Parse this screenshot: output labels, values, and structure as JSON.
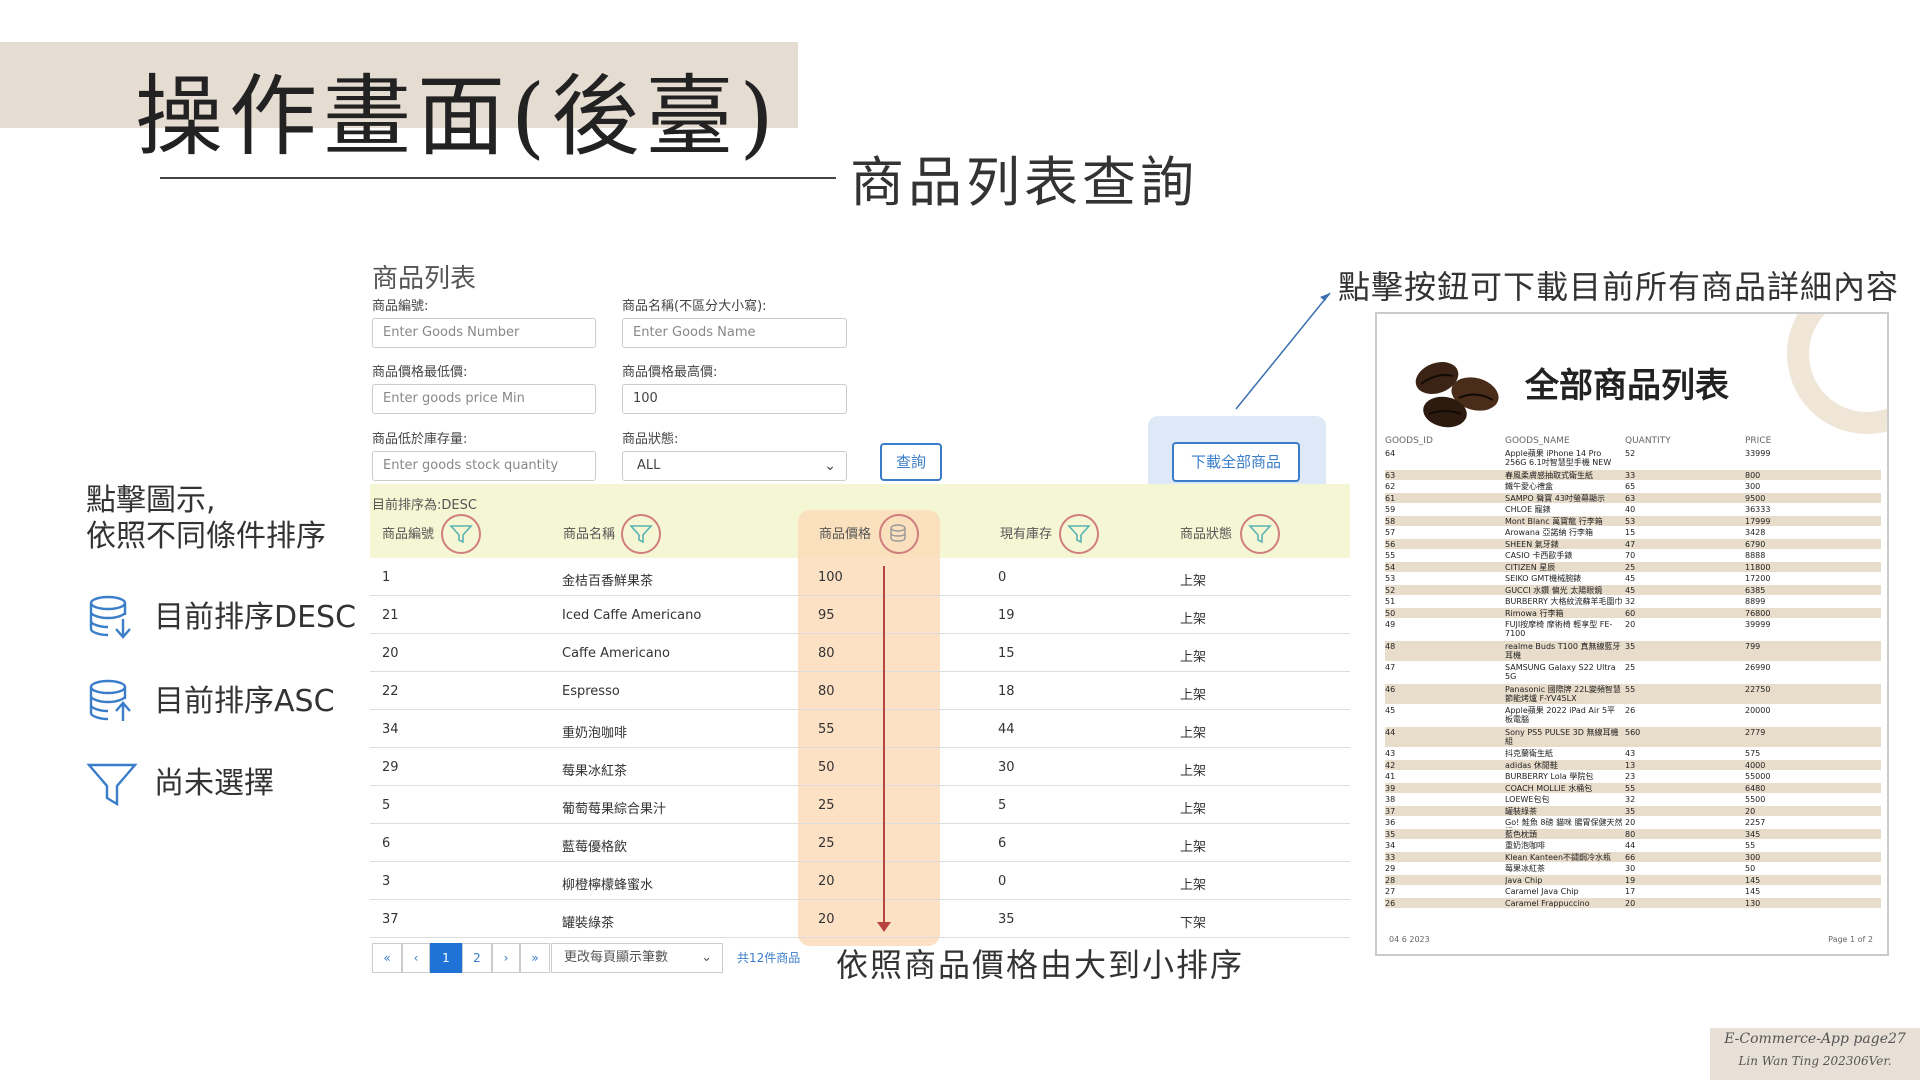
{
  "slide": {
    "title": "操作畫面(後臺)",
    "subtitle": "商品列表查詢",
    "footer_line1": "E-Commerce-App page27",
    "footer_line2": "Lin Wan Ting 202306Ver."
  },
  "form": {
    "title": "商品列表",
    "goods_number_label": "商品編號:",
    "goods_number_placeholder": "Enter Goods Number",
    "goods_name_label": "商品名稱(不區分大小寫):",
    "goods_name_placeholder": "Enter Goods Name",
    "price_min_label": "商品價格最低價:",
    "price_min_placeholder": "Enter goods price Min",
    "price_max_label": "商品價格最高價:",
    "price_max_value": "100",
    "stock_label": "商品低於庫存量:",
    "stock_placeholder": "Enter goods stock quantity",
    "status_label": "商品狀態:",
    "status_value": "ALL",
    "query_button": "查詢",
    "download_button": "下載全部商品"
  },
  "table": {
    "current_sort": "目前排序為:DESC",
    "columns": [
      "商品編號",
      "商品名稱",
      "商品價格",
      "現有庫存",
      "商品狀態"
    ],
    "rows": [
      {
        "id": "1",
        "name": "金桔百香鮮果茶",
        "price": "100",
        "stock": "0",
        "status": "上架"
      },
      {
        "id": "21",
        "name": "Iced Caffe Americano",
        "price": "95",
        "stock": "19",
        "status": "上架"
      },
      {
        "id": "20",
        "name": "Caffe Americano",
        "price": "80",
        "stock": "15",
        "status": "上架"
      },
      {
        "id": "22",
        "name": "Espresso",
        "price": "80",
        "stock": "18",
        "status": "上架"
      },
      {
        "id": "34",
        "name": "重奶泡咖啡",
        "price": "55",
        "stock": "44",
        "status": "上架"
      },
      {
        "id": "29",
        "name": "莓果冰紅茶",
        "price": "50",
        "stock": "30",
        "status": "上架"
      },
      {
        "id": "5",
        "name": "葡萄莓果綜合果汁",
        "price": "25",
        "stock": "5",
        "status": "上架"
      },
      {
        "id": "6",
        "name": "藍莓優格飲",
        "price": "25",
        "stock": "6",
        "status": "上架"
      },
      {
        "id": "3",
        "name": "柳橙檸檬蜂蜜水",
        "price": "20",
        "stock": "0",
        "status": "上架"
      },
      {
        "id": "37",
        "name": "罐裝綠茶",
        "price": "20",
        "stock": "35",
        "status": "下架"
      }
    ]
  },
  "pagination": {
    "first": "«",
    "prev": "‹",
    "page1": "1",
    "page2": "2",
    "next": "›",
    "last": "»",
    "per_page": "更改每頁顯示筆數",
    "total": "共12件商品"
  },
  "annotations": {
    "price_sort_note": "依照商品價格由大到小排序",
    "legend_title_1": "點擊圖示,",
    "legend_title_2": "依照不同條件排序",
    "legend_desc": "目前排序DESC",
    "legend_asc": "目前排序ASC",
    "legend_none": "尚未選擇",
    "download_note": "點擊按鈕可下載目前所有商品詳細內容"
  },
  "pdf": {
    "title": "全部商品列表",
    "headers": [
      "GOODS_ID",
      "GOODS_NAME",
      "QUANTITY",
      "PRICE"
    ],
    "rows": [
      [
        "64",
        "Apple蘋果 iPhone 14 Pro 256G 6.1吋智慧型手機 NEW",
        "52",
        "33999"
      ],
      [
        "63",
        "春風柔膚感抽取式衛生紙",
        "33",
        "800"
      ],
      [
        "62",
        "鐵午愛心禮盒",
        "65",
        "300"
      ],
      [
        "61",
        "SAMPO 聲寶 43吋螢幕顯示",
        "63",
        "9500"
      ],
      [
        "59",
        "CHLOE 寵錶",
        "40",
        "36333"
      ],
      [
        "58",
        "Mont Blanc 萬寶龍 行李箱",
        "53",
        "17999"
      ],
      [
        "57",
        "Arowana 亞諾納 行李箱",
        "15",
        "3428"
      ],
      [
        "56",
        "SHEEN 氣牙錶",
        "47",
        "6790"
      ],
      [
        "55",
        "CASIO 卡西歐手錶",
        "70",
        "8888"
      ],
      [
        "54",
        "CITIZEN 星辰",
        "25",
        "11800"
      ],
      [
        "53",
        "SEIKO GMT機械腕錶",
        "45",
        "17200"
      ],
      [
        "52",
        "GUCCI 水鑽 偏光 太陽眼鏡",
        "45",
        "6385"
      ],
      [
        "51",
        "BURBERRY 大格紋流蘇羊毛圍巾",
        "32",
        "8899"
      ],
      [
        "50",
        "Rimowa 行李箱",
        "60",
        "76800"
      ],
      [
        "49",
        "FUJI按摩椅 摩術椅 輕享型 FE-7100",
        "20",
        "39999"
      ],
      [
        "48",
        "realme Buds T100 真無線藍牙耳機",
        "35",
        "799"
      ],
      [
        "47",
        "SAMSUNG Galaxy S22 Ultra 5G",
        "25",
        "26990"
      ],
      [
        "46",
        "Panasonic 國際牌 22L變頻智慧節能烤爐 F-YV45LX",
        "55",
        "22750"
      ],
      [
        "45",
        "Apple蘋果 2022 iPad Air 5平板電腦",
        "26",
        "20000"
      ],
      [
        "44",
        "Sony PS5 PULSE 3D 無線耳機組",
        "560",
        "2779"
      ],
      [
        "43",
        "抖克蘭衛生紙",
        "43",
        "575"
      ],
      [
        "42",
        "adidas 休閒鞋",
        "13",
        "4000"
      ],
      [
        "41",
        "BURBERRY Lola 學院包",
        "23",
        "55000"
      ],
      [
        "39",
        "COACH MOLLIE 水桶包",
        "55",
        "6480"
      ],
      [
        "38",
        "LOEWE包包",
        "32",
        "5500"
      ],
      [
        "37",
        "罐裝綠茶",
        "35",
        "20"
      ],
      [
        "36",
        "Go! 鮭魚 8磅 貓咪 腸胃保健天然糧",
        "20",
        "2257"
      ],
      [
        "35",
        "藍色枕頭",
        "80",
        "345"
      ],
      [
        "34",
        "重奶泡咖啡",
        "44",
        "55"
      ],
      [
        "33",
        "Klean Kanteen不鏽鋼冷水瓶",
        "66",
        "300"
      ],
      [
        "29",
        "莓果冰紅茶",
        "30",
        "50"
      ],
      [
        "28",
        "Java Chip",
        "19",
        "145"
      ],
      [
        "27",
        "Caramel Java Chip",
        "17",
        "145"
      ],
      [
        "26",
        "Caramel Frappuccino",
        "20",
        "130"
      ]
    ],
    "footer_date": "04 6 2023",
    "footer_page": "Page 1 of 2"
  },
  "icons": {
    "desc_icon": "database-arrow-down-icon",
    "asc_icon": "database-arrow-up-icon",
    "filter_icon": "filter-funnel-icon"
  },
  "colors": {
    "accent_blue": "#3a7dc9",
    "title_band": "#e5dcd2",
    "highlight_price": "#fbd9b6",
    "highlight_sort": "#f5f7d4",
    "circle_red": "#d07d7d"
  }
}
